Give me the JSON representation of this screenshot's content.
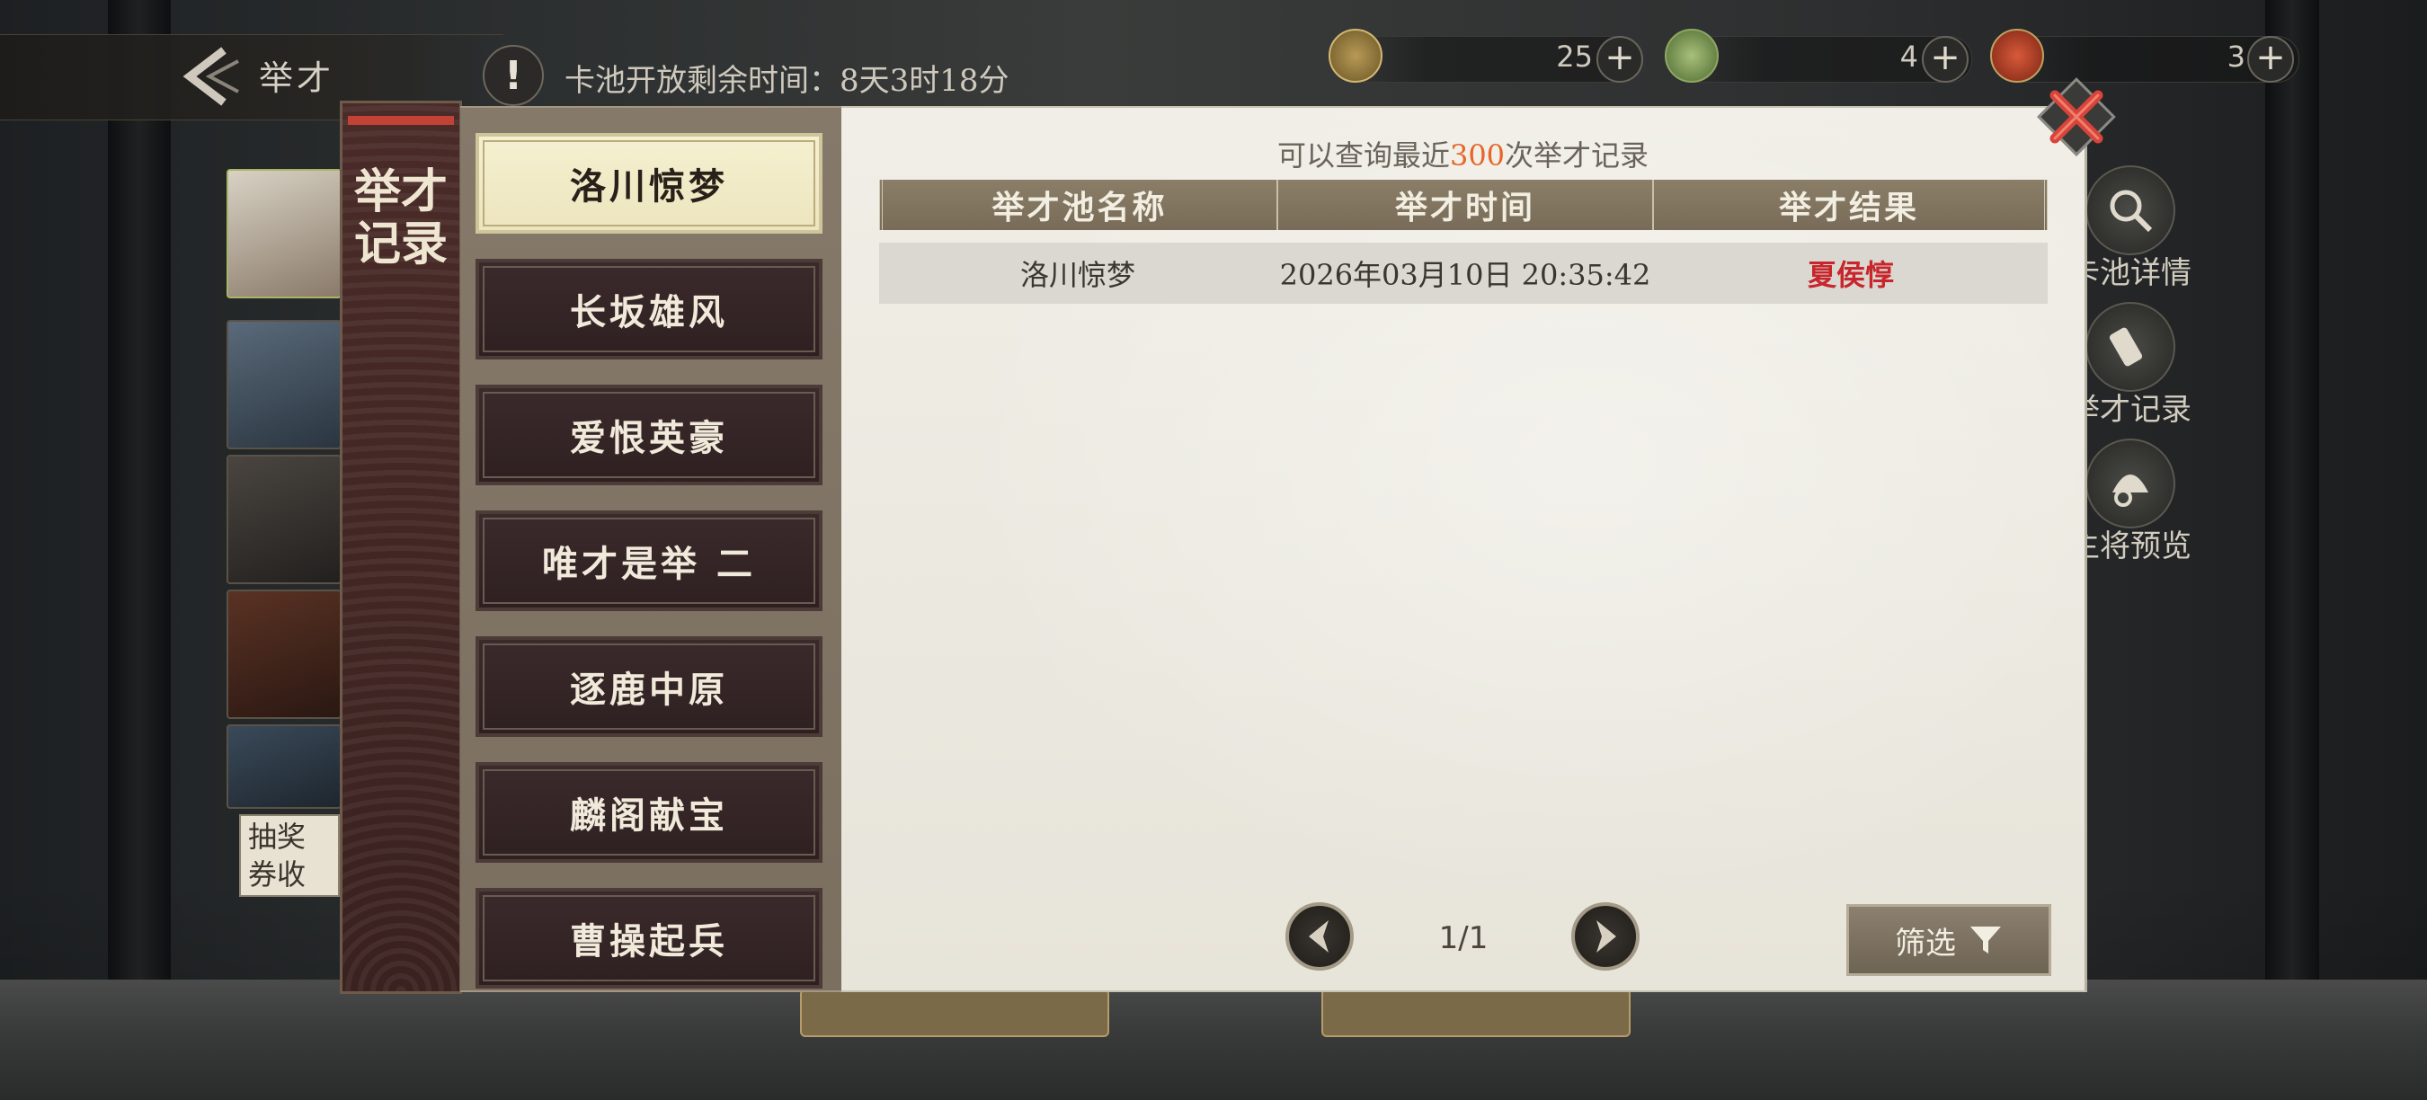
{
  "header": {
    "back_title": "举才",
    "timer_text": "卡池开放剩余时间：8天3时18分"
  },
  "resources": [
    {
      "icon": "copper-coin-icon",
      "value": "25"
    },
    {
      "icon": "jade-token-icon",
      "value": "4"
    },
    {
      "icon": "red-seal-icon",
      "value": "3"
    }
  ],
  "side_buttons": [
    {
      "icon": "magnifier-icon",
      "label": "卡池详情"
    },
    {
      "icon": "scroll-brush-icon",
      "label": "举才记录"
    },
    {
      "icon": "helmet-icon",
      "label": "主将预览"
    }
  ],
  "behind_text": "抽奖券收集攻",
  "modal": {
    "tab_title": "举才记录",
    "pool_tabs": [
      "洛川惊梦",
      "长坂雄风",
      "爱恨英豪",
      "唯才是举 二",
      "逐鹿中原",
      "麟阁献宝",
      "曹操起兵"
    ],
    "active_tab_index": 0,
    "info_prefix": "可以查询最近",
    "info_count": "300",
    "info_suffix": "次举才记录",
    "columns": [
      "举才池名称",
      "举才时间",
      "举才结果"
    ],
    "rows": [
      {
        "pool": "洛川惊梦",
        "time": "2026年03月10日  20:35:42",
        "result": "夏侯惇"
      }
    ],
    "page_indicator": "1/1",
    "filter_label": "筛选",
    "colors": {
      "highlight": "#e8662a",
      "result_red": "#c8252c"
    }
  }
}
